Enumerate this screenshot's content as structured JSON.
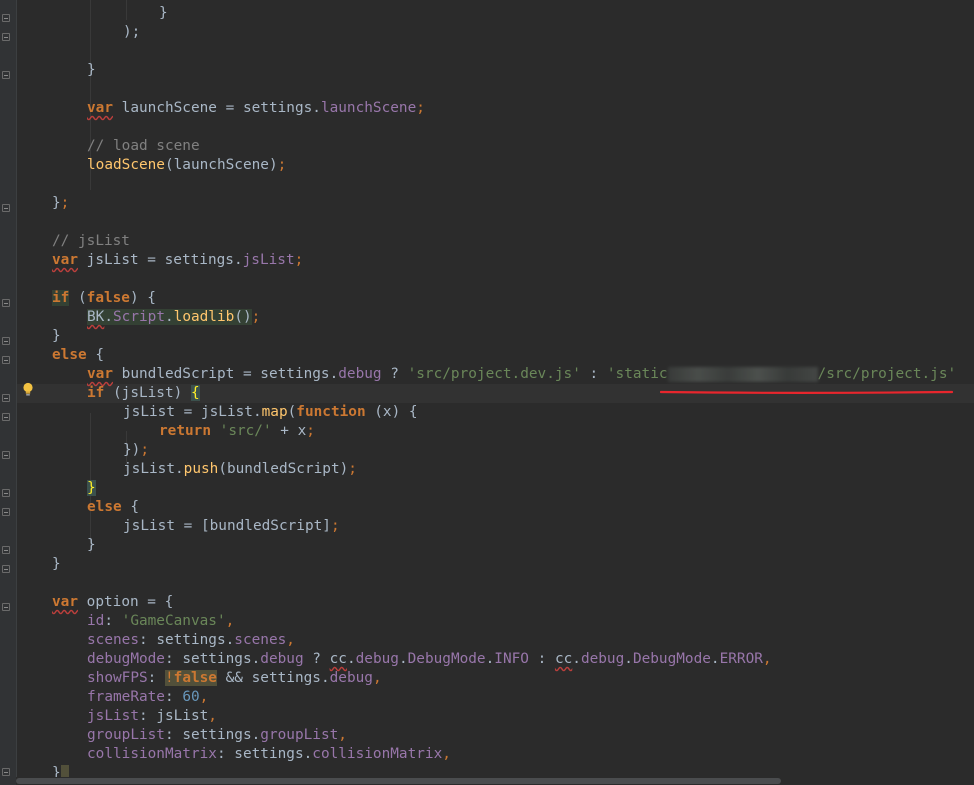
{
  "code_lines": [
    {
      "id": "l1",
      "text": "}"
    },
    {
      "id": "l2",
      "text": ");"
    },
    {
      "id": "l3",
      "text": "}"
    },
    {
      "id": "l4a",
      "text": "var"
    },
    {
      "id": "l4b",
      "text": " launchScene = settings."
    },
    {
      "id": "l4c",
      "text": "launchScene"
    },
    {
      "id": "l4d",
      "text": ";"
    },
    {
      "id": "l5",
      "text": "// load scene"
    },
    {
      "id": "l6a",
      "text": "loadScene"
    },
    {
      "id": "l6b",
      "text": "(launchScene)"
    },
    {
      "id": "l6c",
      "text": ";"
    }
  ],
  "tokens": {
    "var": "var",
    "if": "if",
    "else": "else",
    "false": "false",
    "function": "function",
    "return": "return",
    "semicolon": ";",
    "comma": ",",
    "close_brace": "}",
    "close_brace_semi": "};",
    "close_paren_semi": ");",
    "open_brace": " {",
    "comment_load_scene": "// load scene",
    "comment_jslist": "// jsList",
    "launchScene_decl": " launchScene = settings.",
    "launchScene_prop": "launchScene",
    "loadScene_fn": "loadScene",
    "loadScene_args": "(launchScene)",
    "jsList_decl": " jsList = settings.",
    "jsList_prop": "jsList",
    "if_open": " (",
    "if_close": ") {",
    "bk": "BK",
    "dot": ".",
    "script": "Script",
    "loadlib": "loadlib",
    "parens": "()",
    "bundled_decl": " bundledScript = settings.",
    "debug_prop": "debug",
    "ternary_q": " ? ",
    "str_dev": "'src/project.dev.js'",
    "ternary_c": " : ",
    "str_static_start": "'static",
    "str_static_end": "/src/project.js'",
    "if_jslist": " (jsList) ",
    "brace_open_hl": "{",
    "jslist_assign": "jsList = jsList.",
    "map_fn": "map",
    "paren_open": "(",
    "fn_args": " (x) {",
    "str_src": "'src/'",
    "plus_x": " + x",
    "close_brace_paren": "})",
    "jslist_dot": "jsList.",
    "push_fn": "push",
    "push_args": "(bundledScript)",
    "brace_close_hl": "}",
    "jslist_assign_arr": "jsList = [bundledScript]",
    "option_decl": " option = {",
    "key_id": "id",
    "colon": ": ",
    "str_gamecanvas": "'GameCanvas'",
    "key_scenes": "scenes",
    "settings_dot": "settings.",
    "prop_scenes": "scenes",
    "key_debugmode": "debugMode",
    "cc": "cc",
    "debug_word": "debug",
    "debugmode_word": "DebugMode",
    "info_word": "INFO",
    "error_word": "ERROR",
    "key_showfps": "showFPS",
    "bang": "!",
    "and_settings": " && settings.",
    "key_framerate": "frameRate",
    "num_60": "60",
    "key_jslist": "jsList",
    "jslist_val": "jsList",
    "key_grouplist": "groupList",
    "prop_grouplist": "groupList",
    "key_collision": "collisionMatrix",
    "prop_collision": "collisionMatrix"
  },
  "colors": {
    "background": "#2b2b2b",
    "keyword": "#cc7832",
    "function": "#ffc66d",
    "property": "#9876aa",
    "string": "#6a8759",
    "number": "#6897bb",
    "comment": "#808080",
    "annotation": "#e8262d"
  },
  "icons": [
    "fold-marker-icon",
    "lightbulb-icon"
  ]
}
